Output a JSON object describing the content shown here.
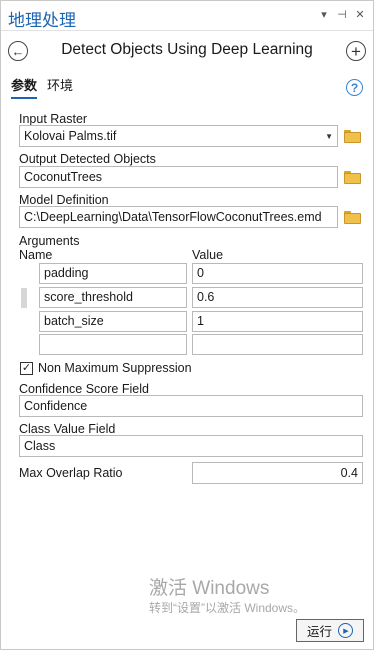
{
  "titlebar": {
    "title": "地理处理",
    "controls": [
      "▾",
      "⊣",
      "✕"
    ]
  },
  "header": {
    "title": "Detect Objects Using Deep Learning",
    "back_icon": "←",
    "add_icon": "+"
  },
  "tabs": [
    {
      "label": "参数",
      "active": true
    },
    {
      "label": "环境",
      "active": false
    }
  ],
  "help_icon": "?",
  "form": {
    "input_raster": {
      "label": "Input Raster",
      "value": "Kolovai Palms.tif"
    },
    "output_objects": {
      "label": "Output Detected Objects",
      "value": "CoconutTrees"
    },
    "model_definition": {
      "label": "Model Definition",
      "value": "C:\\DeepLearning\\Data\\TensorFlowCoconutTrees.emd"
    },
    "arguments": {
      "label": "Arguments",
      "col_name": "Name",
      "col_value": "Value",
      "rows": [
        {
          "name": "padding",
          "value": "0"
        },
        {
          "name": "score_threshold",
          "value": "0.6"
        },
        {
          "name": "batch_size",
          "value": "1"
        },
        {
          "name": "",
          "value": ""
        }
      ]
    },
    "nms": {
      "label": "Non Maximum Suppression",
      "checked": true,
      "check_mark": "✓"
    },
    "confidence_field": {
      "label": "Confidence Score Field",
      "value": "Confidence"
    },
    "class_field": {
      "label": "Class Value Field",
      "value": "Class"
    },
    "max_overlap": {
      "label": "Max Overlap Ratio",
      "value": "0.4"
    }
  },
  "watermark": {
    "line1": "激活 Windows",
    "line2": "转到“设置”以激活 Windows。"
  },
  "run_button": {
    "label": "运行",
    "icon": "▶"
  }
}
